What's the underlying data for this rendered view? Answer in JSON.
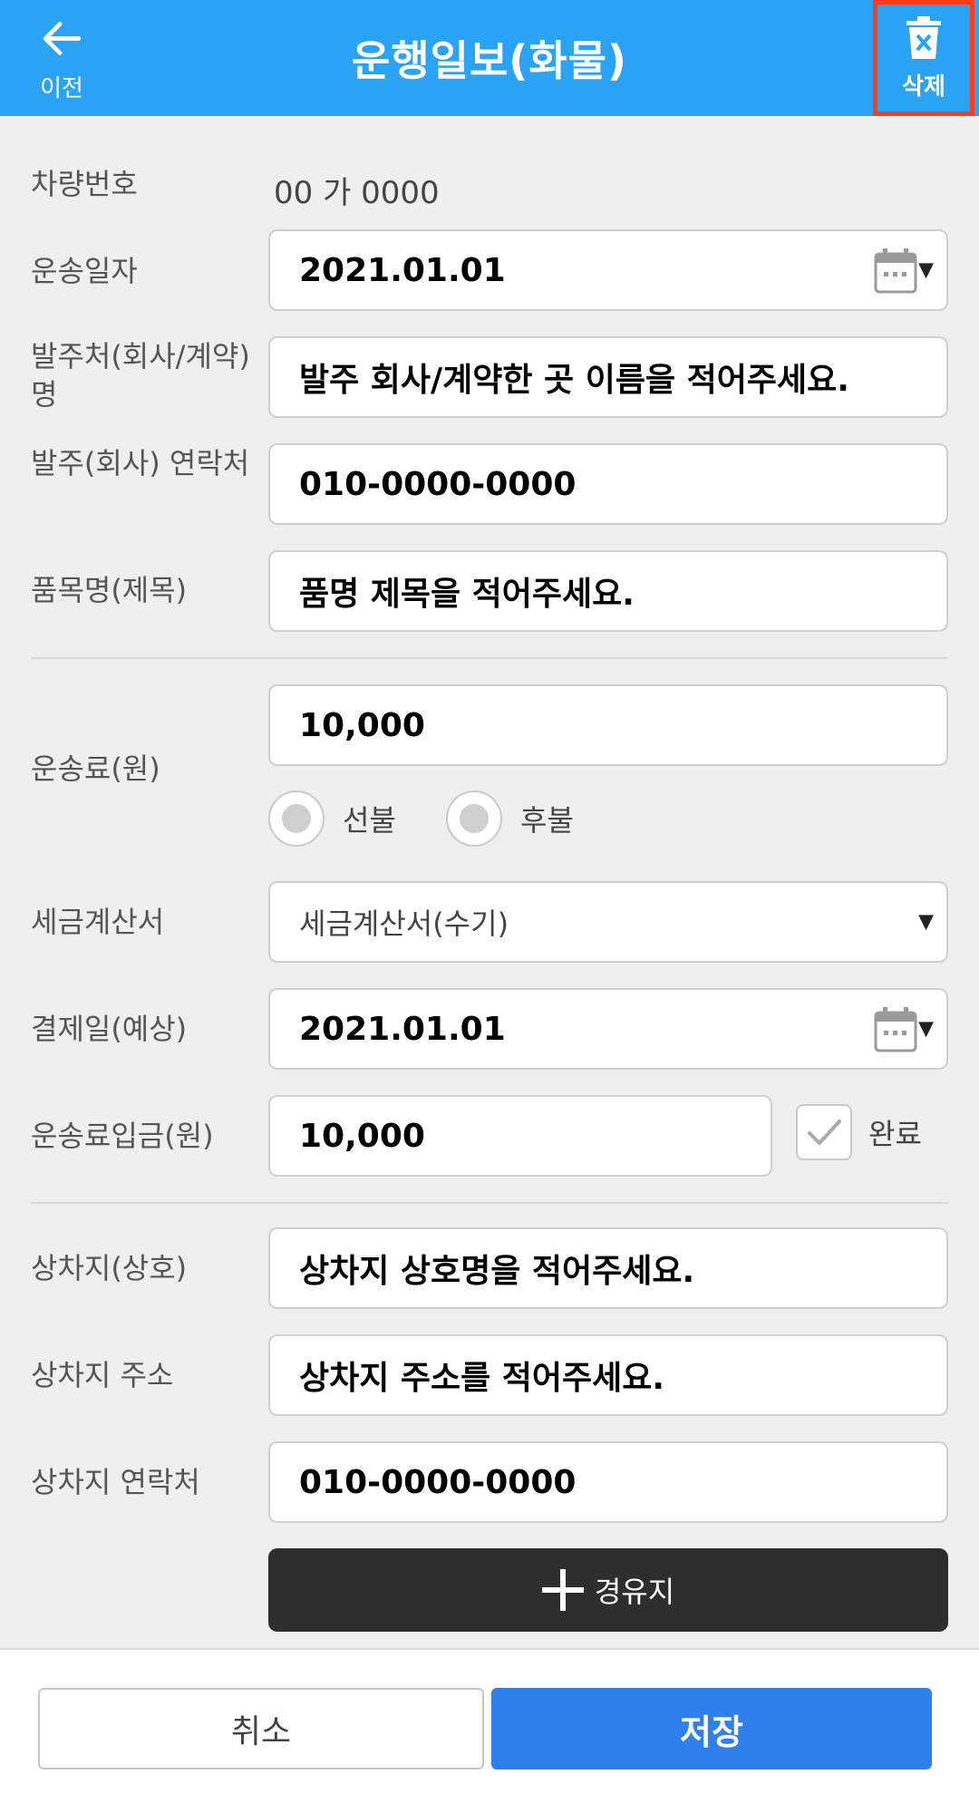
{
  "header": {
    "back_label": "이전",
    "title": "운행일보(화물)",
    "delete_label": "삭제"
  },
  "vehicle": {
    "label": "차량번호",
    "value": "00 가 0000"
  },
  "transport_date": {
    "label": "운송일자",
    "value": "2021.01.01"
  },
  "client_name": {
    "label": "발주처(회사/계약)명",
    "value": "발주 회사/계약한 곳 이름을 적어주세요."
  },
  "client_contact": {
    "label": "발주(회사) 연락처",
    "value": "010-0000-0000"
  },
  "item_name": {
    "label": "품목명(제목)",
    "value": "품명 제목을 적어주세요."
  },
  "fare": {
    "label": "운송료(원)",
    "value": "10,000",
    "options": [
      "선불",
      "후불"
    ]
  },
  "tax_invoice": {
    "label": "세금계산서",
    "value": "세금계산서(수기)"
  },
  "payment_date": {
    "label": "결제일(예상)",
    "value": "2021.01.01"
  },
  "fare_deposit": {
    "label": "운송료입금(원)",
    "value": "10,000",
    "done_label": "완료",
    "done_checked": true
  },
  "loading_place": {
    "label": "상차지(상호)",
    "value": "상차지 상호명을 적어주세요."
  },
  "loading_address": {
    "label": "상차지 주소",
    "value": "상차지 주소를 적어주세요."
  },
  "loading_contact": {
    "label": "상차지 연락처",
    "value": "010-0000-0000"
  },
  "waypoint_label": "경유지",
  "footer": {
    "cancel_label": "취소",
    "save_label": "저장"
  },
  "colors": {
    "header": "#2aa3f5",
    "delete_highlight": "#ff3b1f",
    "save": "#2f80ed",
    "waypoint": "#2e2e2e"
  }
}
